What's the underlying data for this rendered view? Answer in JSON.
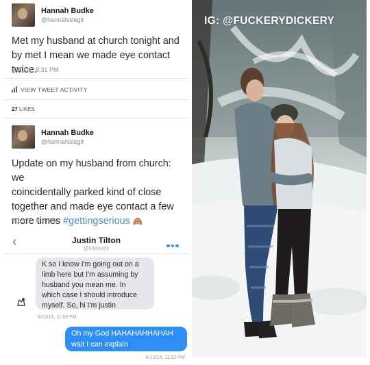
{
  "tweet1": {
    "name": "Hannah Budke",
    "handle": "@hannahislegit",
    "text": "Met my husband at church tonight and by met I mean we made eye contact twice.",
    "timestamp": "5/30/15, 8:31 PM",
    "activity_label": "VIEW TWEET ACTIVITY",
    "likes_count": "27",
    "likes_label": "LIKES"
  },
  "tweet2": {
    "name": "Hannah Budke",
    "handle": "@hannahislegit",
    "text_lines": [
      "Update on my husband from church: we",
      "coincidentally parked kind of close",
      "together and made eye contact a few",
      "more times"
    ],
    "hashtag": "#gettingserious",
    "emoji": "🙈",
    "timestamp": "6/13/15, 8:10 PM"
  },
  "imessage": {
    "contact_name": "Justin Tilton",
    "contact_handle": "@tiltdaddy",
    "incoming_lines": [
      "K so I know I'm going out on a",
      "limb here but I'm assuming by",
      "husband you mean me. In",
      "which case I should introduce",
      "myself. So, hi I'm justin"
    ],
    "incoming_time": "6/13/15, 11:08 PM",
    "outgoing_lines": [
      "Oh my God HAHAHAHHAHAH",
      "wait I can explain"
    ],
    "outgoing_time": "6/13/15, 11:22 PM"
  },
  "photo": {
    "watermark": "IG: @FUCKERYDICKERY"
  },
  "colors": {
    "hashtag": "#4a90c8",
    "imessage_blue": "#2f8ef3",
    "incoming_bubble": "#e6e6eb"
  }
}
